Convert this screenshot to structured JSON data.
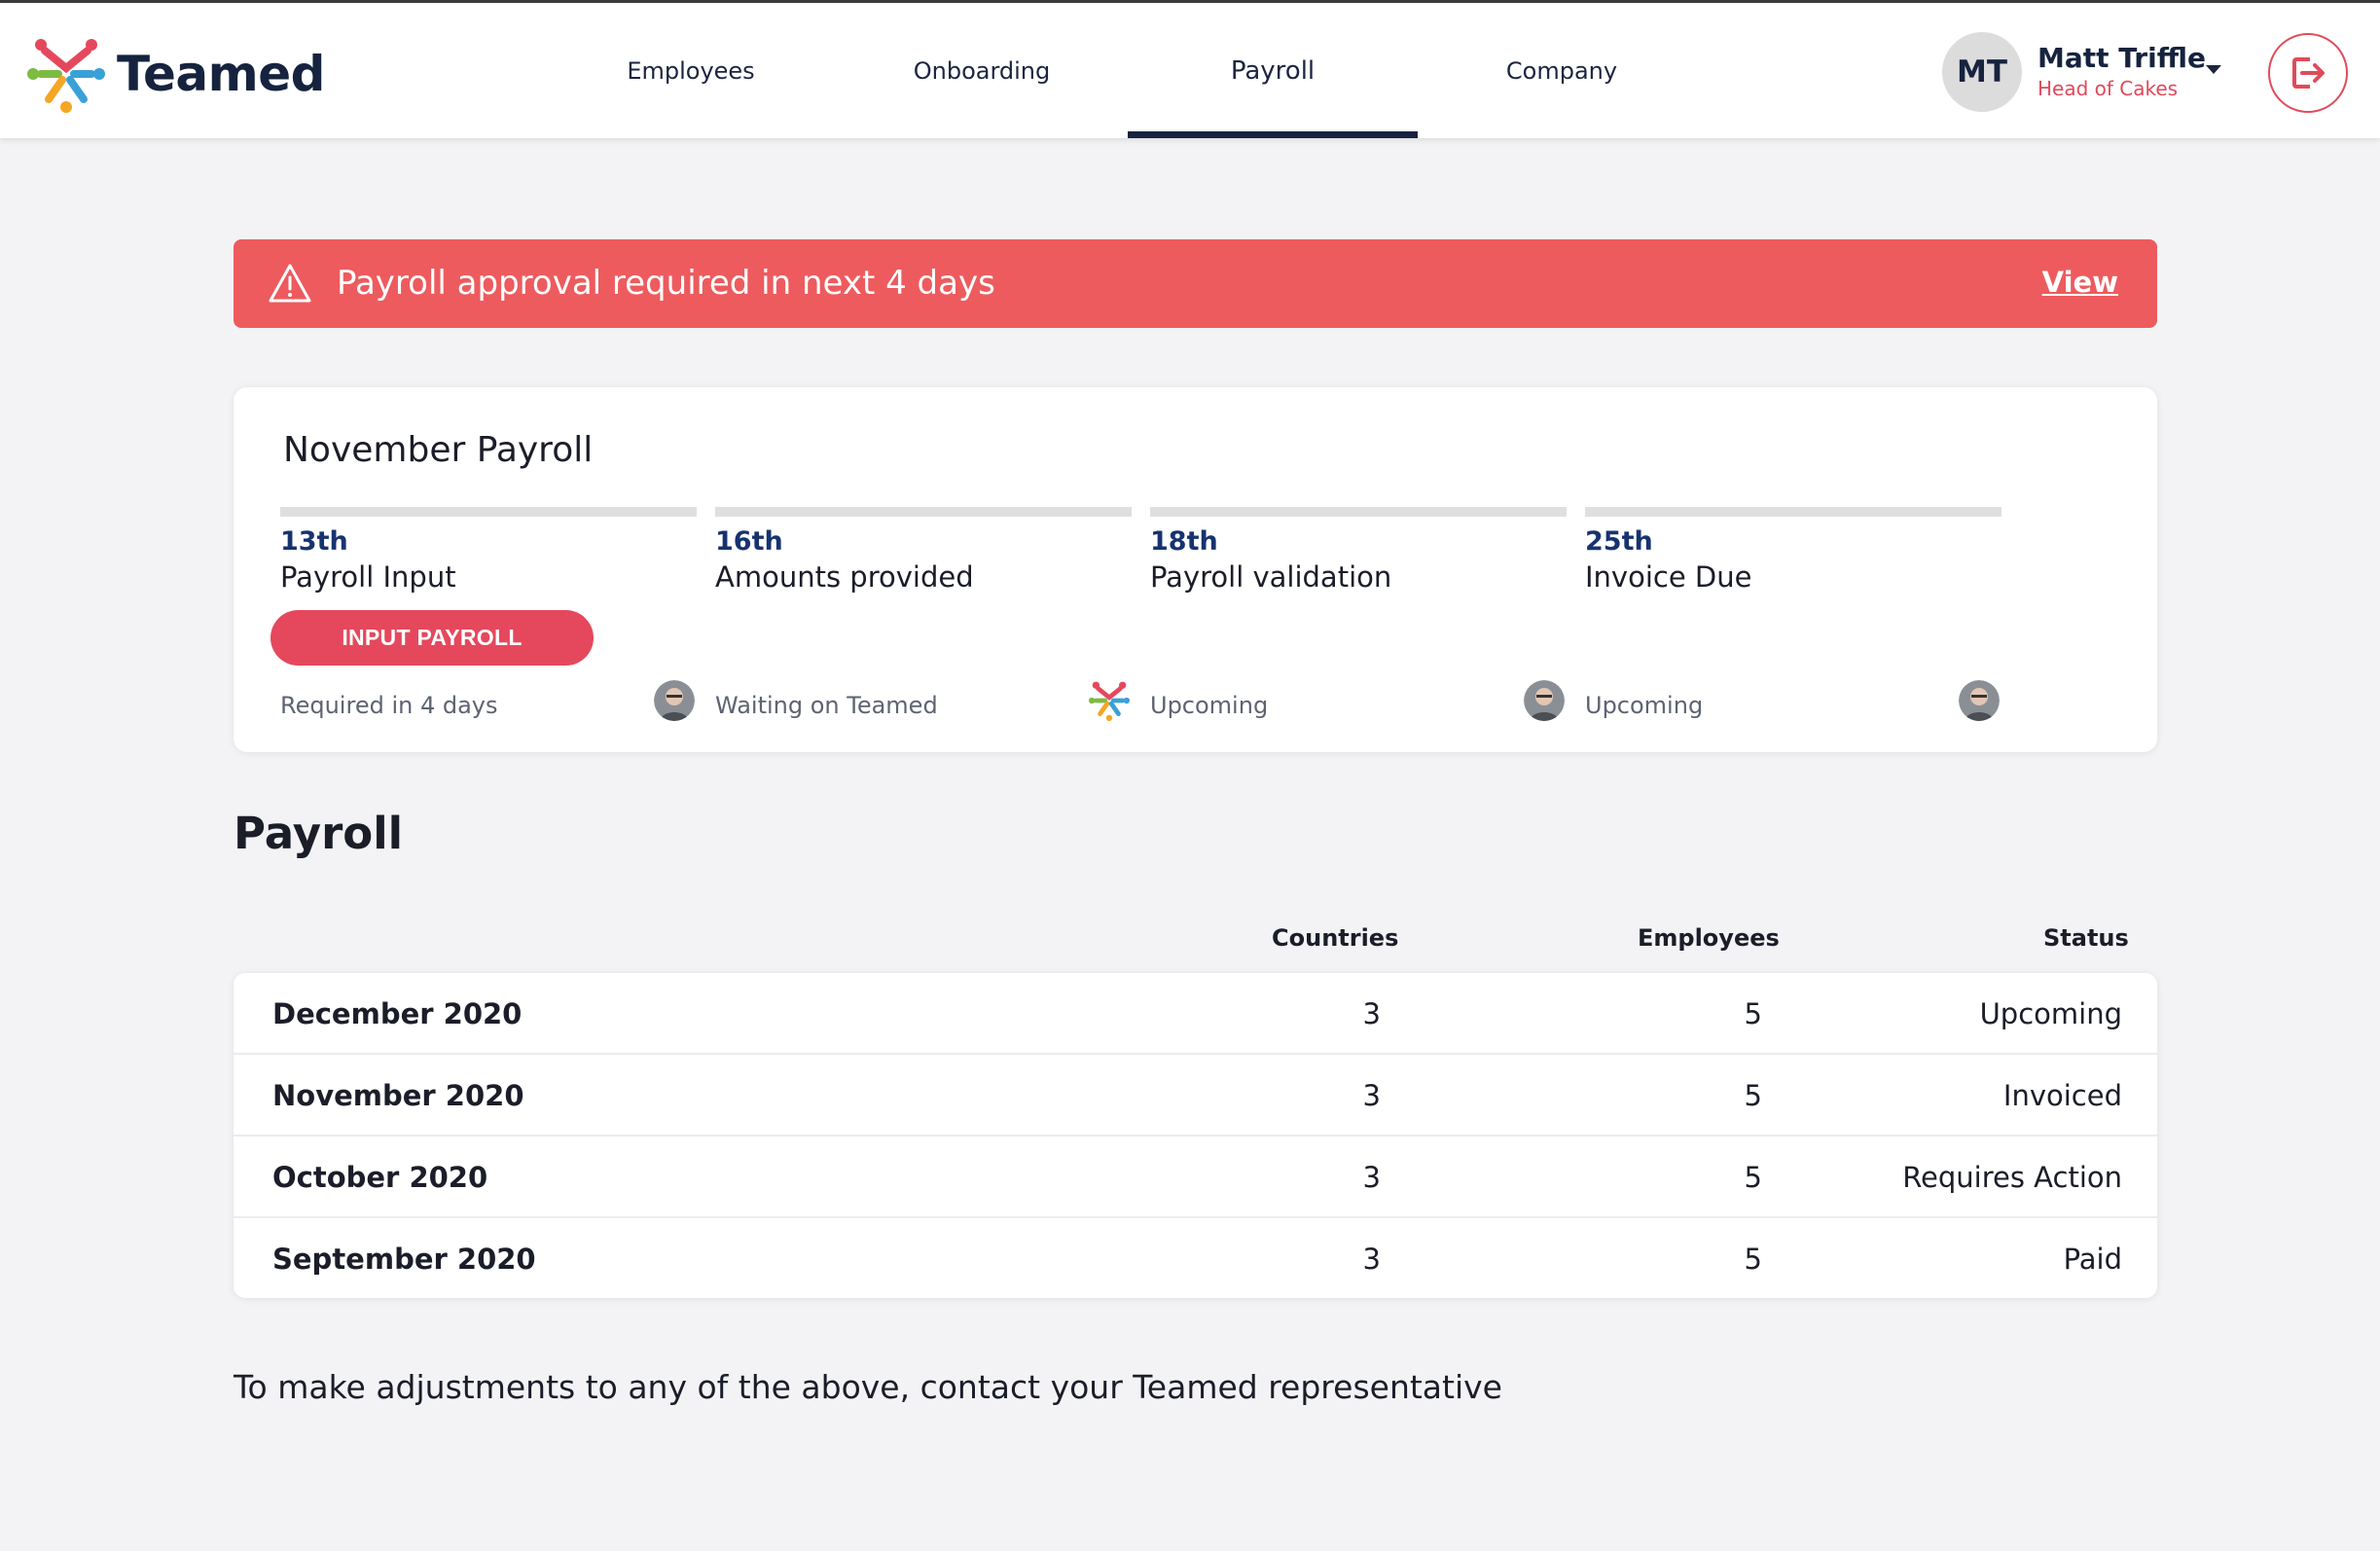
{
  "app": {
    "name": "Teamed",
    "brand_colors": {
      "navy": "#16233f",
      "red": "#e5485d",
      "alert": "#ed5b5e",
      "date_blue": "#17336f"
    }
  },
  "nav": {
    "tabs": [
      {
        "label": "Employees",
        "active": false
      },
      {
        "label": "Onboarding",
        "active": false
      },
      {
        "label": "Payroll",
        "active": true
      },
      {
        "label": "Company",
        "active": false
      }
    ]
  },
  "user": {
    "initials": "MT",
    "name": "Matt Triffle",
    "role": "Head of Cakes",
    "menu_icon": "chevron-down-icon",
    "logout_icon": "logout-icon"
  },
  "alert": {
    "icon": "warning-icon",
    "text": "Payroll approval required in next 4 days",
    "action": "View"
  },
  "payroll_card": {
    "title": "November Payroll",
    "steps": [
      {
        "date": "13th",
        "label": "Payroll Input",
        "button": "INPUT PAYROLL",
        "status": "Required in 4 days",
        "owner_icon": "user-avatar"
      },
      {
        "date": "16th",
        "label": "Amounts provided",
        "status": "Waiting on Teamed",
        "owner_icon": "teamed-logo"
      },
      {
        "date": "18th",
        "label": "Payroll validation",
        "status": "Upcoming",
        "owner_icon": "user-avatar"
      },
      {
        "date": "25th",
        "label": "Invoice Due",
        "status": "Upcoming",
        "owner_icon": "user-avatar"
      }
    ]
  },
  "payroll_section": {
    "title": "Payroll",
    "columns": {
      "countries": "Countries",
      "employees": "Employees",
      "status": "Status"
    },
    "rows": [
      {
        "period": "December 2020",
        "countries": "3",
        "employees": "5",
        "status": "Upcoming"
      },
      {
        "period": "November 2020",
        "countries": "3",
        "employees": "5",
        "status": "Invoiced"
      },
      {
        "period": "October 2020",
        "countries": "3",
        "employees": "5",
        "status": "Requires Action"
      },
      {
        "period": "September 2020",
        "countries": "3",
        "employees": "5",
        "status": "Paid"
      }
    ]
  },
  "footer": {
    "note": "To make adjustments to any of the above, contact your Teamed representative"
  }
}
